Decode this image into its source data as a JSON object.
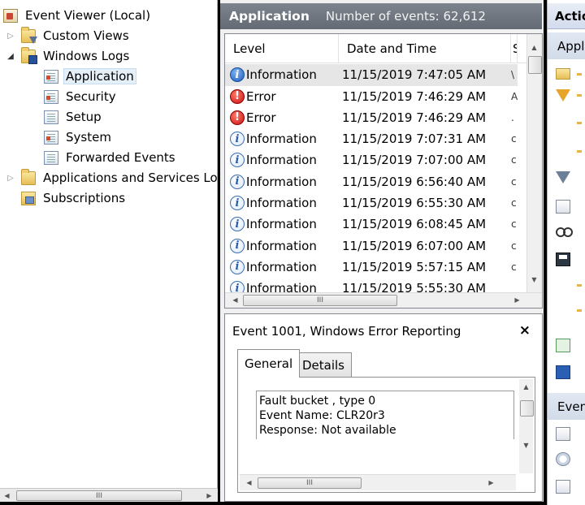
{
  "tree": {
    "items": [
      {
        "label": "Event Viewer (Local)",
        "icon": "event-viewer-icon"
      },
      {
        "label": "Custom Views",
        "icon": "filter-folder-icon",
        "expander": "▷"
      },
      {
        "label": "Windows Logs",
        "icon": "logs-folder-icon",
        "expander": "◢"
      },
      {
        "label": "Application",
        "icon": "log-icon",
        "selected": true
      },
      {
        "label": "Security",
        "icon": "log-icon"
      },
      {
        "label": "Setup",
        "icon": "log-icon"
      },
      {
        "label": "System",
        "icon": "log-icon"
      },
      {
        "label": "Forwarded Events",
        "icon": "log-icon"
      },
      {
        "label": "Applications and Services Lo",
        "icon": "folder-icon",
        "expander": "▷"
      },
      {
        "label": "Subscriptions",
        "icon": "subscriptions-icon"
      }
    ]
  },
  "middle": {
    "header_title": "Application",
    "header_count": "Number of events: 62,612",
    "columns": {
      "level": "Level",
      "datetime": "Date and Time",
      "source": "S"
    },
    "rows": [
      {
        "level": "Information",
        "datetime": "11/15/2019 7:47:05 AM",
        "source": "\\",
        "type": "info",
        "selected": true
      },
      {
        "level": "Error",
        "datetime": "11/15/2019 7:46:29 AM",
        "source": "A",
        "type": "error"
      },
      {
        "level": "Error",
        "datetime": "11/15/2019 7:46:29 AM",
        "source": ".",
        "type": "error"
      },
      {
        "level": "Information",
        "datetime": "11/15/2019 7:07:31 AM",
        "source": "c",
        "type": "info"
      },
      {
        "level": "Information",
        "datetime": "11/15/2019 7:07:00 AM",
        "source": "c",
        "type": "info"
      },
      {
        "level": "Information",
        "datetime": "11/15/2019 6:56:40 AM",
        "source": "c",
        "type": "info"
      },
      {
        "level": "Information",
        "datetime": "11/15/2019 6:55:30 AM",
        "source": "c",
        "type": "info"
      },
      {
        "level": "Information",
        "datetime": "11/15/2019 6:08:45 AM",
        "source": "c",
        "type": "info"
      },
      {
        "level": "Information",
        "datetime": "11/15/2019 6:07:00 AM",
        "source": "c",
        "type": "info"
      },
      {
        "level": "Information",
        "datetime": "11/15/2019 5:57:15 AM",
        "source": "c",
        "type": "info"
      },
      {
        "level": "Information",
        "datetime": "11/15/2019 5:55:30 AM",
        "source": "",
        "type": "info"
      }
    ],
    "detail": {
      "title": "Event 1001, Windows Error Reporting",
      "close": "×",
      "tabs": {
        "general": "General",
        "details": "Details"
      },
      "description_lines": [
        "Fault bucket , type 0",
        "Event Name: CLR20r3",
        "Response: Not available"
      ]
    }
  },
  "actions": {
    "header": "Actio",
    "section1": "Appl",
    "section2": "Even"
  },
  "scroll": {
    "up": "▲",
    "down": "▼",
    "left": "◀",
    "right": "▶",
    "grip": "III"
  }
}
